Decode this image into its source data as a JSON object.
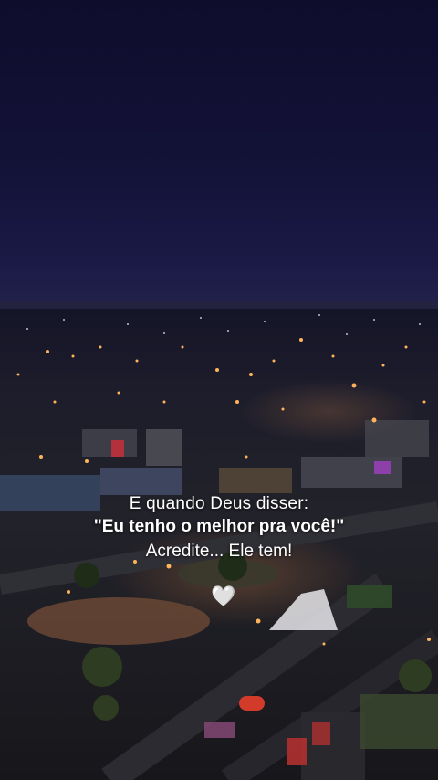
{
  "caption": {
    "line1": "E quando Deus disser:",
    "line2": "\"Eu tenho o melhor pra você!\"",
    "line3": "Acredite... Ele tem!"
  },
  "heart": {
    "icon": "white-heart-icon",
    "glyph": "🤍"
  },
  "colors": {
    "sky": "#131238",
    "city_light": "#ffb35c",
    "text": "#ffffff"
  }
}
